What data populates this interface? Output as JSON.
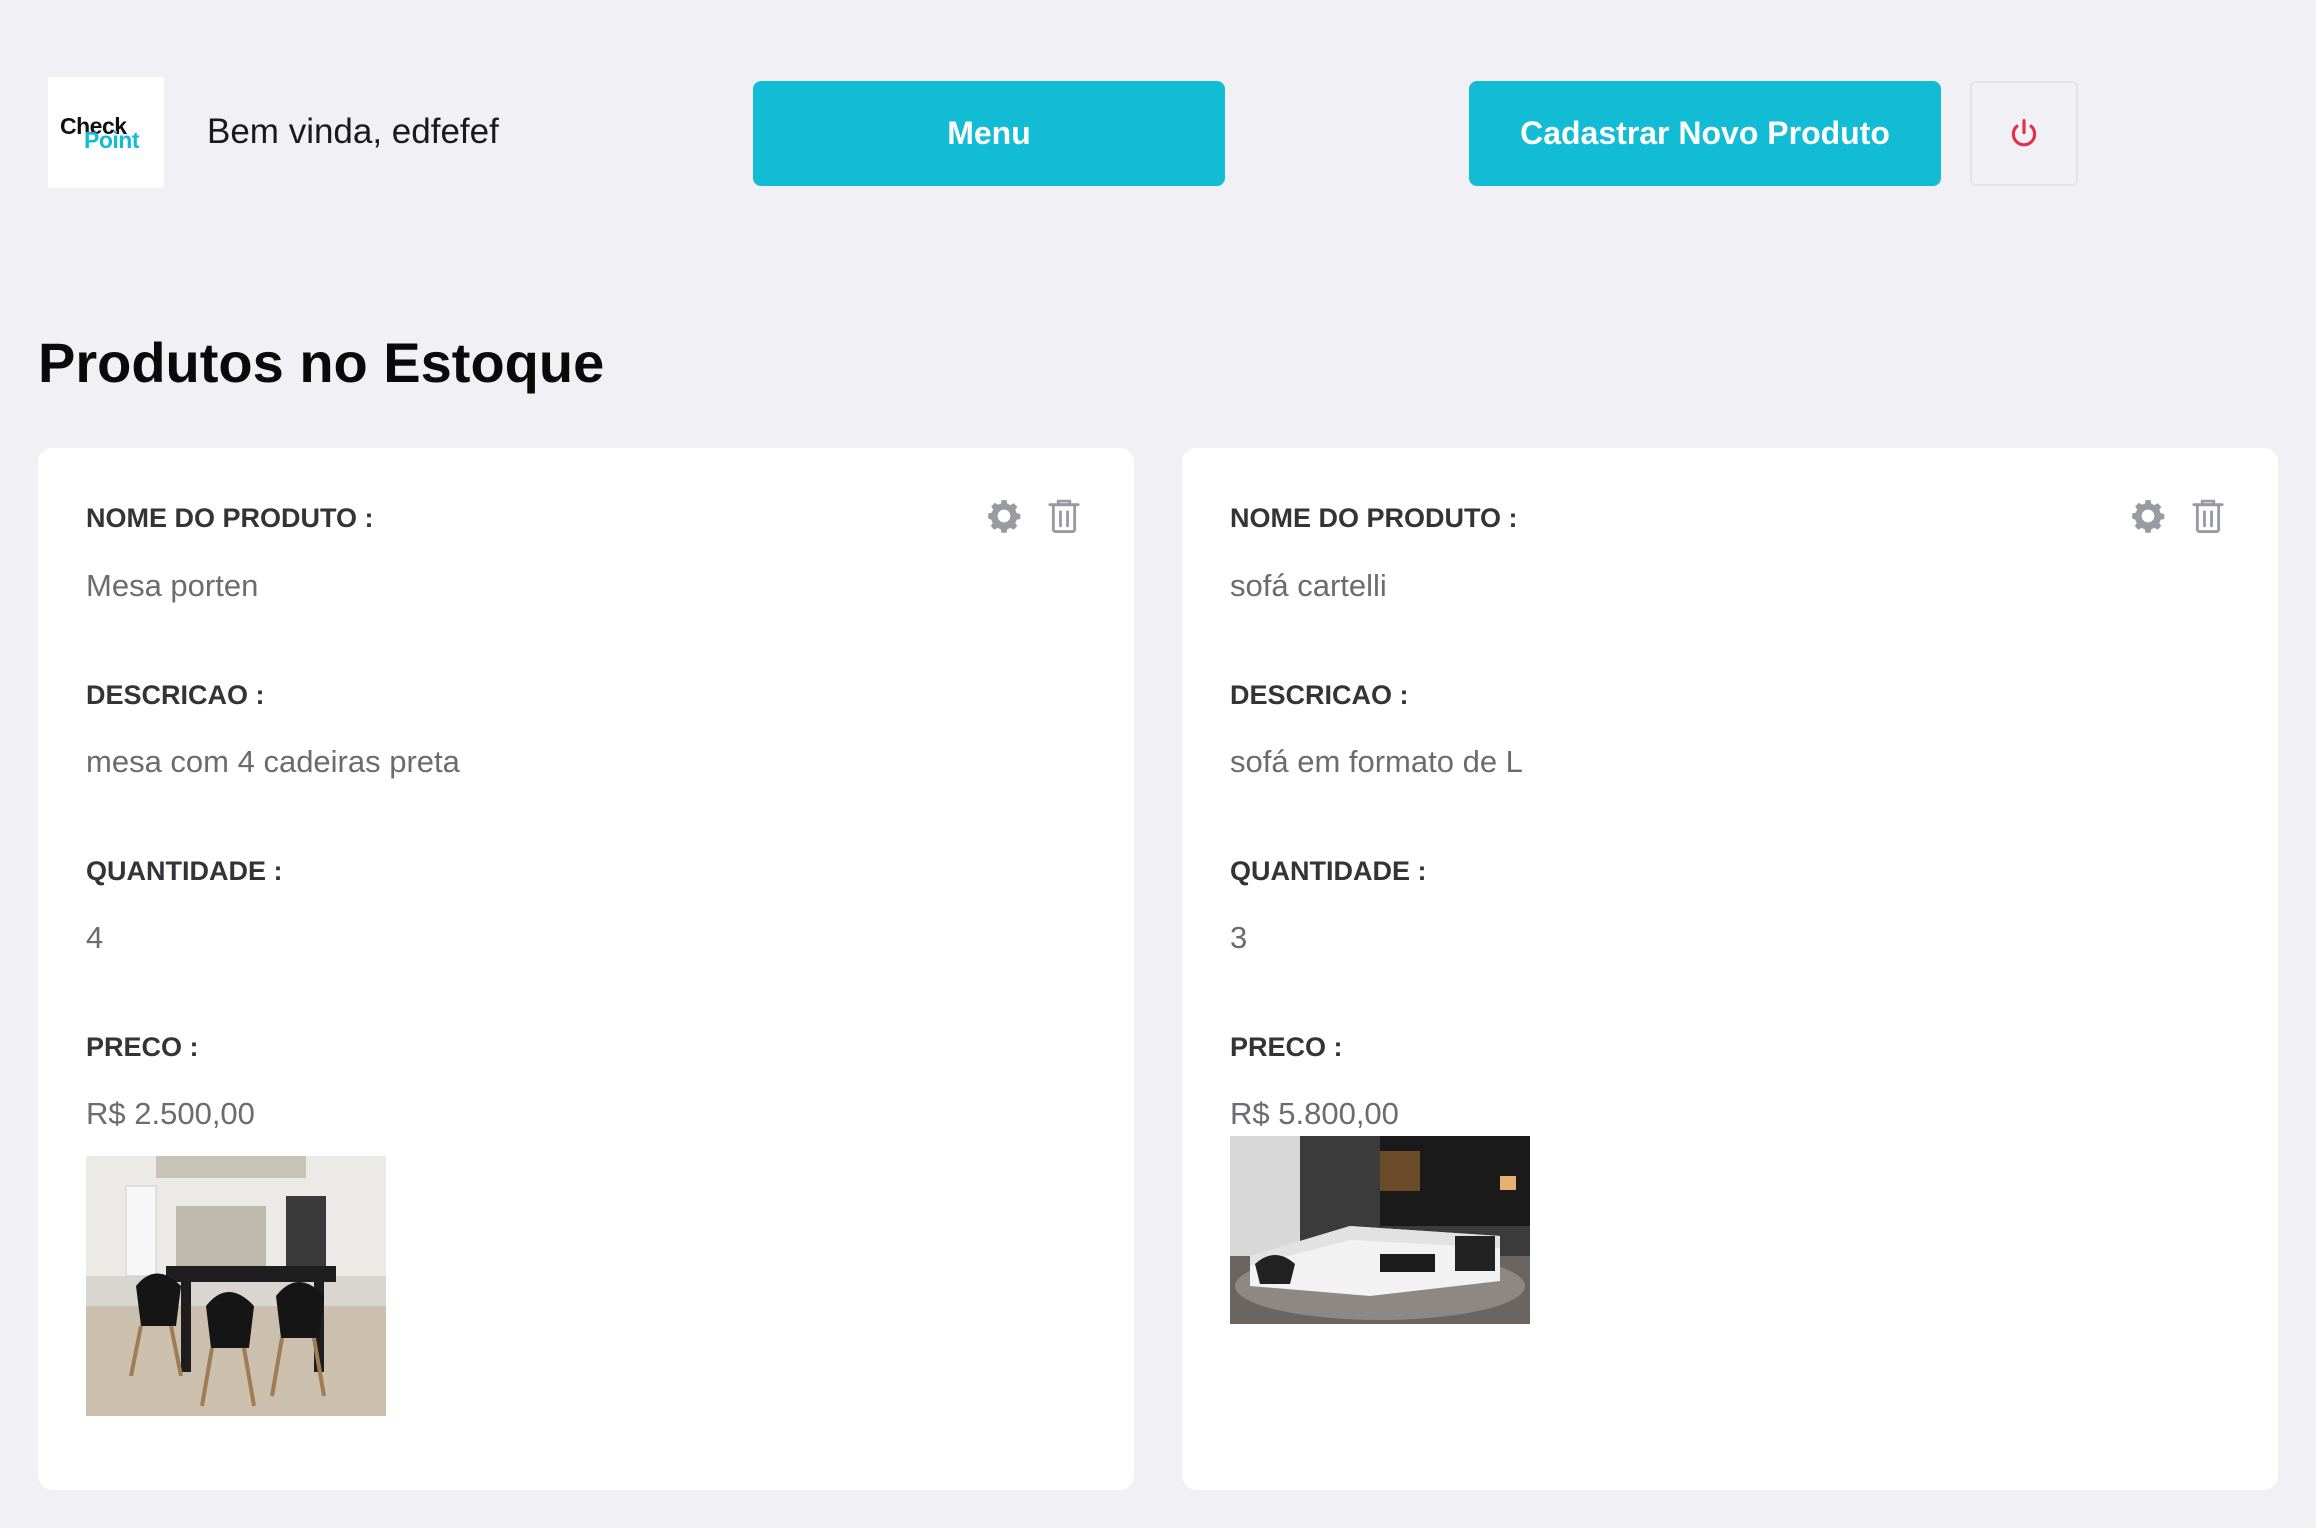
{
  "header": {
    "logo": {
      "line1": "Check",
      "line2": "Point",
      "accent": "#12bcd4"
    },
    "welcome": "Bem vinda, edfefef",
    "menu_label": "Menu",
    "new_product_label": "Cadastrar Novo Produto",
    "power_icon": "power-icon",
    "power_color": "#e0304e"
  },
  "page_title": "Produtos no Estoque",
  "labels": {
    "name": "NOME DO PRODUTO :",
    "description": "DESCRICAO :",
    "quantity": "QUANTIDADE :",
    "price": "PRECO :"
  },
  "products": [
    {
      "name": "Mesa porten",
      "description": "mesa com 4 cadeiras preta",
      "quantity": "4",
      "price": "R$ 2.500,00",
      "image": "dining-table-photo"
    },
    {
      "name": "sofá cartelli",
      "description": "sofá em formato de L",
      "quantity": "3",
      "price": "R$ 5.800,00",
      "image": "sectional-sofa-photo"
    }
  ],
  "colors": {
    "accent": "#12bcd4",
    "background": "#f0f0f5",
    "icon_gray": "#9a9aa2"
  }
}
